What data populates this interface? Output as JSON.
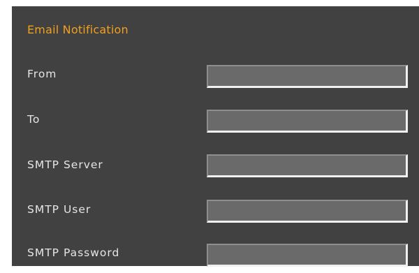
{
  "section": {
    "title": "Email Notification",
    "title_color": "#f0a020",
    "background_color": "#414141"
  },
  "fields": [
    {
      "label": "From",
      "value": "",
      "type": "text"
    },
    {
      "label": "To",
      "value": "",
      "type": "text"
    },
    {
      "label": "SMTP Server",
      "value": "",
      "type": "text"
    },
    {
      "label": "SMTP User",
      "value": "",
      "type": "text"
    },
    {
      "label": "SMTP Password",
      "value": "",
      "type": "password"
    }
  ]
}
